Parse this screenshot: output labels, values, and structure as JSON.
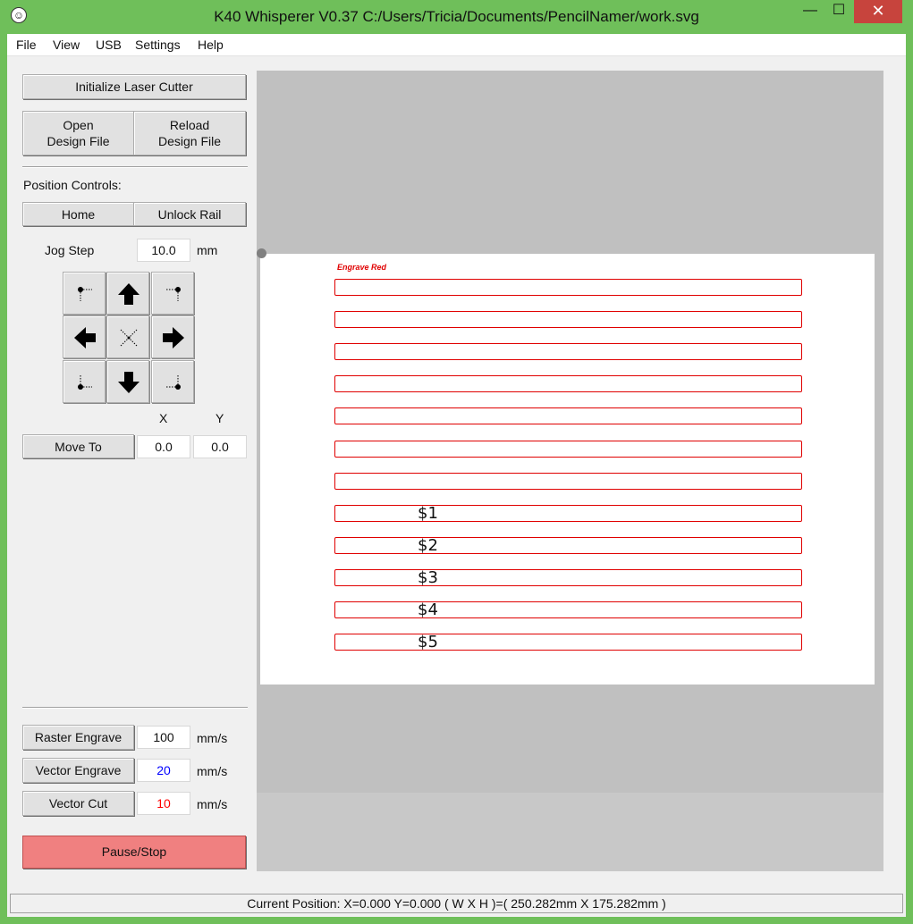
{
  "window": {
    "title": "K40 Whisperer V0.37    C:/Users/Tricia/Documents/PencilNamer/work.svg",
    "min_glyph": "—",
    "max_glyph": "☐",
    "close_glyph": "✕",
    "app_icon_glyph": "☺"
  },
  "menu": [
    "File",
    "View",
    "USB",
    "Settings",
    "Help"
  ],
  "left_panel": {
    "init_label": "Initialize Laser Cutter",
    "open_label": "Open\nDesign File",
    "reload_label": "Reload\nDesign File",
    "position_controls_label": "Position Controls:",
    "home_label": "Home",
    "unlock_label": "Unlock Rail",
    "jog_step_label": "Jog Step",
    "jog_step_value": "10.0",
    "jog_step_unit": "mm",
    "x_label": "X",
    "y_label": "Y",
    "move_to_label": "Move To",
    "move_x": "0.0",
    "move_y": "0.0",
    "raster_label": "Raster Engrave",
    "raster_value": "100",
    "vector_engrave_label": "Vector Engrave",
    "vector_engrave_value": "20",
    "vector_cut_label": "Vector Cut",
    "vector_cut_value": "10",
    "speed_unit": "mm/s",
    "pause_label": "Pause/Stop"
  },
  "canvas": {
    "caption": "Engrave Red",
    "rows": [
      "",
      "",
      "",
      "",
      "",
      "",
      "",
      "$1",
      "$2",
      "$3",
      "$4",
      "$5"
    ]
  },
  "status": {
    "text": "Current Position: X=0.000 Y=0.000    ( W X H )=( 250.282mm X 175.282mm )"
  },
  "colors": {
    "title_bg": "#6fbf5a",
    "close_btn": "#c7443d",
    "cut_red": "#e00000",
    "vector_engrave_blue": "#0000ff",
    "vector_cut_red": "#ff0000",
    "pause_btn": "#f08080"
  }
}
